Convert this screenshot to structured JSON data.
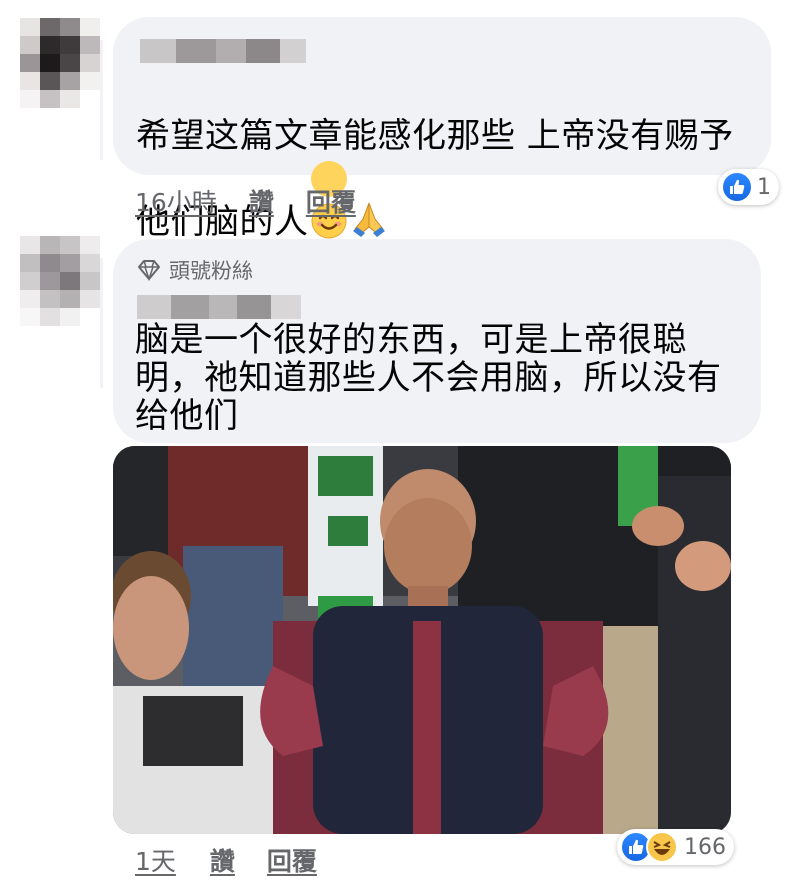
{
  "comments": [
    {
      "text": "希望这篇文章能感化那些 上帝没有赐予\n他们脑的人",
      "emojis": [
        "smiling-face-icon",
        "folded-hands-icon"
      ],
      "time": "16小時",
      "like_label": "讚",
      "reply_label": "回覆",
      "reaction_count": "1",
      "reaction_types": [
        "like"
      ]
    },
    {
      "badge": "頭號粉絲",
      "badge_icon": "diamond-icon",
      "text": "脑是一个很好的东西，可是上帝很聪\n明，祂知道那些人不会用脑，所以没有\n给他们",
      "image": "meme-photo",
      "time": "1天",
      "like_label": "讚",
      "reply_label": "回覆",
      "reaction_count": "166",
      "reaction_types": [
        "like",
        "haha"
      ]
    }
  ],
  "colors": {
    "bubble": "#f0f2f5",
    "meta_text": "#65676b",
    "like_blue": "#1877f2"
  }
}
